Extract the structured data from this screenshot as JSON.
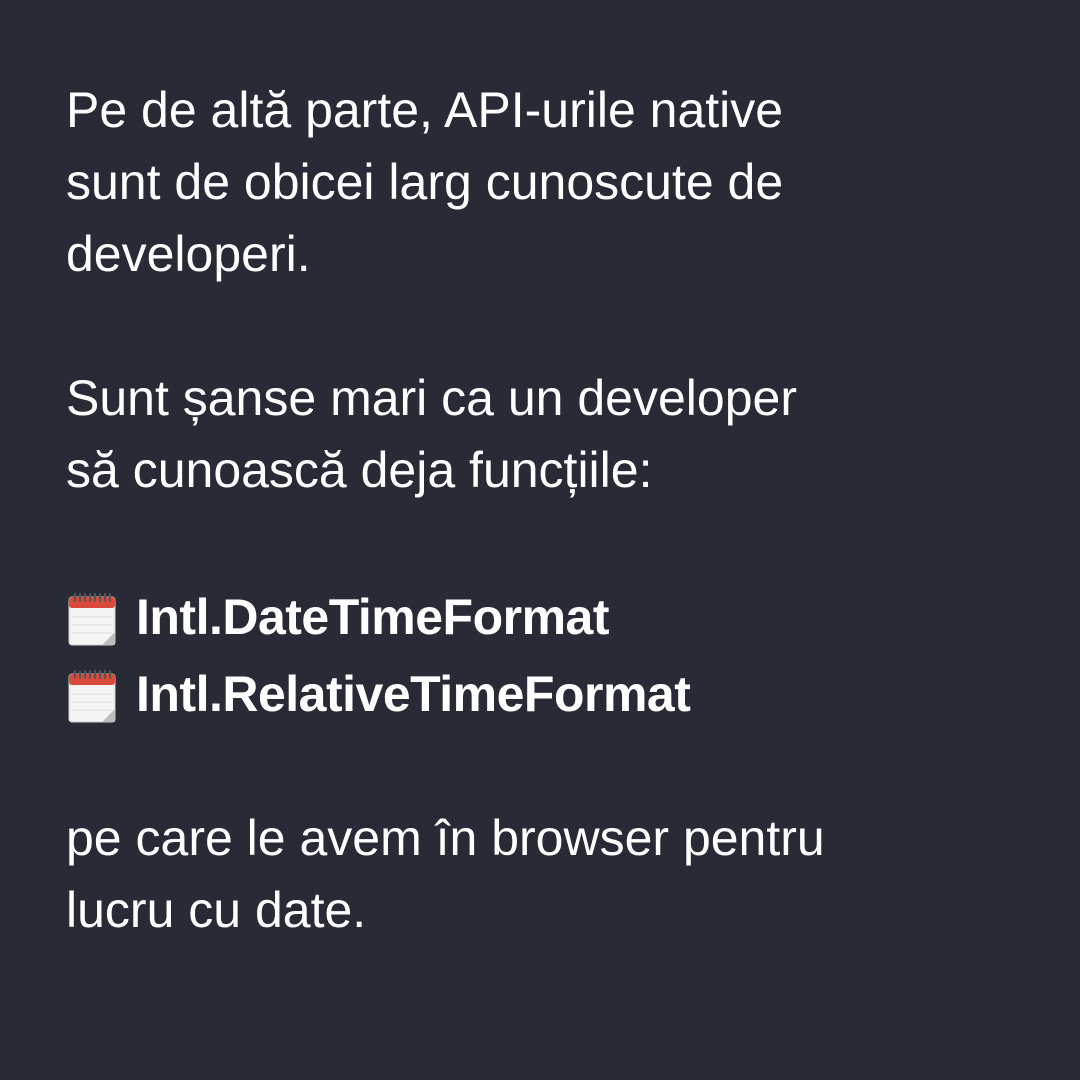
{
  "colors": {
    "background": "#282a35",
    "text": "#ffffff"
  },
  "paragraph1": {
    "lines": [
      "Pe de altă parte, API-urile native",
      "sunt de obicei larg cunoscute de",
      "developeri."
    ]
  },
  "paragraph2": {
    "lines": [
      "Sunt șanse mari ca un developer",
      "să cunoască deja funcțiile:"
    ]
  },
  "api_list": {
    "icon": "calendar-icon",
    "items": [
      "Intl.DateTimeFormat",
      "Intl.RelativeTimeFormat"
    ]
  },
  "paragraph3": {
    "lines": [
      "pe care le avem în browser pentru",
      "lucru cu date."
    ]
  }
}
